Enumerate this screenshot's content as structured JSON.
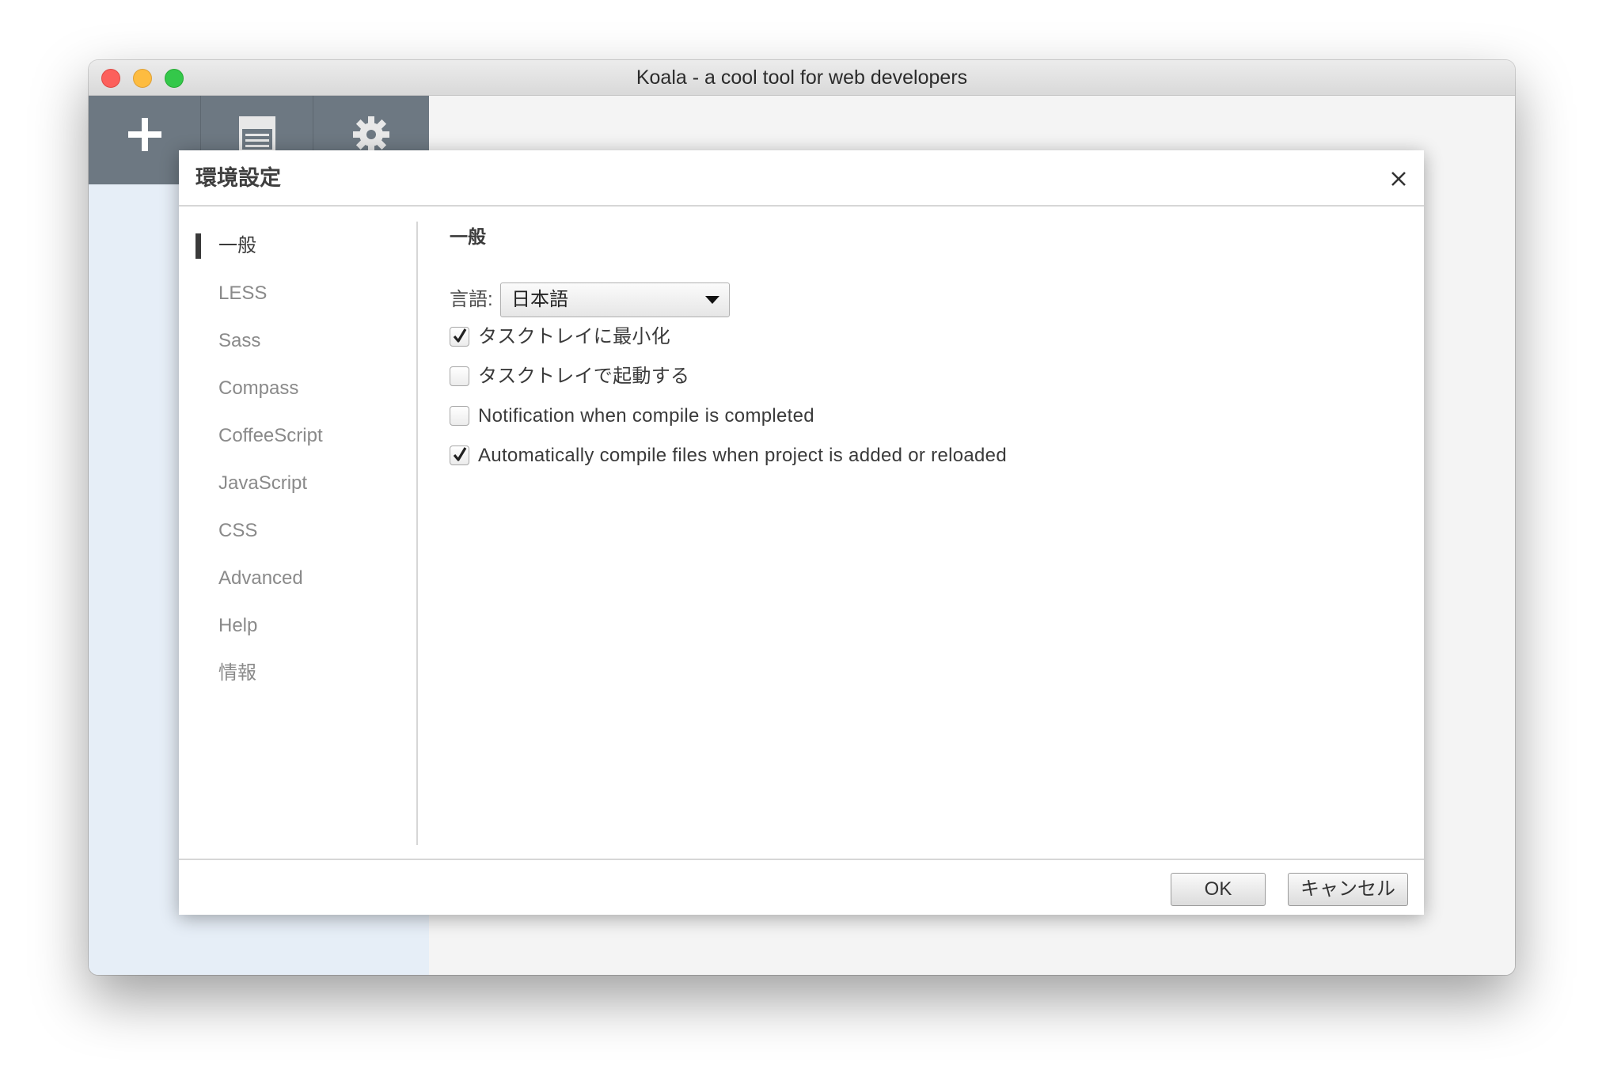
{
  "window": {
    "title": "Koala - a cool tool for web developers"
  },
  "toolbar": {
    "add_icon": "plus-icon",
    "log_icon": "document-icon",
    "settings_icon": "gear-icon"
  },
  "dialog": {
    "title": "環境設定",
    "close_icon": "close-icon",
    "nav": [
      {
        "label": "一般",
        "active": true
      },
      {
        "label": "LESS"
      },
      {
        "label": "Sass"
      },
      {
        "label": "Compass"
      },
      {
        "label": "CoffeeScript"
      },
      {
        "label": "JavaScript"
      },
      {
        "label": "CSS"
      },
      {
        "label": "Advanced"
      },
      {
        "label": "Help"
      },
      {
        "label": "情報"
      }
    ],
    "section_title": "一般",
    "language": {
      "label": "言語:",
      "value": "日本語"
    },
    "options": [
      {
        "label": "タスクトレイに最小化",
        "checked": true
      },
      {
        "label": "タスクトレイで起動する",
        "checked": false
      },
      {
        "label": "Notification when compile is completed",
        "checked": false
      },
      {
        "label": "Automatically compile files when project is added or reloaded",
        "checked": true
      }
    ],
    "ok_label": "OK",
    "cancel_label": "キャンセル"
  }
}
